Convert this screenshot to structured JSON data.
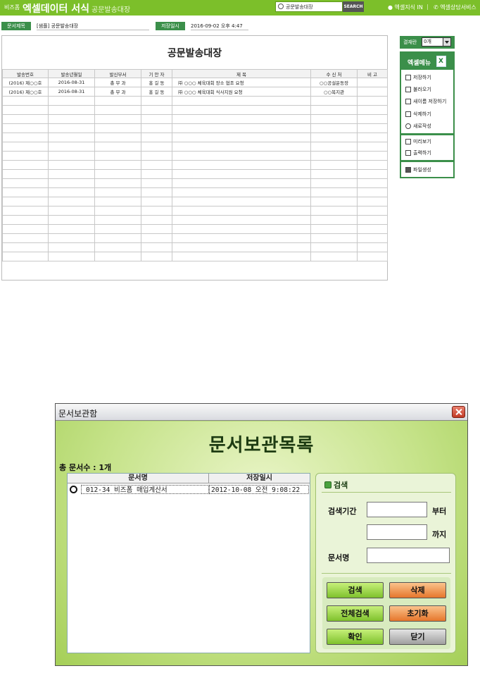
{
  "header": {
    "brand_small": "비즈폼",
    "brand_main": "엑셀데이터 서식",
    "brand_sub": "공문발송대장",
    "search_value": "공문발송대장",
    "search_button": "SEARCH",
    "link_knowledge": "엑셀지식 IN",
    "link_consult": "엑셀상담서비스"
  },
  "info": {
    "doc_title_label": "문서제목",
    "doc_title_value": "[샘플] 공문발송대장",
    "saved_label": "저장일시",
    "saved_value": "2016-09-02  오후 4:47"
  },
  "document": {
    "title": "공문발송대장",
    "columns": [
      "발송번호",
      "발송년월일",
      "발신부서",
      "기 안 자",
      "제        목",
      "수 신 처",
      "비    고"
    ],
    "rows": [
      [
        "(2016) 제○○호",
        "2016-08-31",
        "총 무 과",
        "홍 길 동",
        "㈜ ○○○ 체육대회 장소 협조 요청",
        "○○공설운동장",
        ""
      ],
      [
        "(2016) 제○○호",
        "2016-08-31",
        "총 무 과",
        "홍 길 동",
        "㈜ ○○○ 체육대회 식사지원 요청",
        "○○복지관",
        ""
      ]
    ]
  },
  "sidebar": {
    "approval_label": "결재란",
    "approval_value": "0개",
    "menu_title": "엑셀메뉴",
    "items": [
      {
        "label": "저장하기",
        "icon": "save-icon"
      },
      {
        "label": "불러오기",
        "icon": "load-icon"
      },
      {
        "label": "새이름 저장하기",
        "icon": "save-as-icon"
      },
      {
        "label": "삭제하기",
        "icon": "trash-icon"
      },
      {
        "label": "새로작성",
        "icon": "new-doc-icon"
      },
      {
        "label": "미리보기",
        "icon": "preview-icon"
      },
      {
        "label": "출력하기",
        "icon": "print-icon"
      },
      {
        "label": "파일생성",
        "icon": "folder-icon"
      }
    ]
  },
  "dialog": {
    "title": "문서보관함",
    "heading": "문서보관목록",
    "count_text": "총 문서수 : 1개",
    "list_headers": [
      "문서명",
      "저장일시"
    ],
    "list_rows": [
      {
        "name": "012-34_비즈폼 매입계산서",
        "date": "2012-10-08 오전 9:08:22"
      }
    ],
    "search_title": "검색",
    "period_label": "검색기간",
    "from_label": "부터",
    "to_label": "까지",
    "docname_label": "문서명",
    "buttons": {
      "search": "검색",
      "delete": "삭제",
      "search_all": "전체검색",
      "reset": "초기화",
      "confirm": "확인",
      "close": "닫기"
    }
  },
  "colors": {
    "topbar": "#7cbf2a",
    "accent_green": "#3b8f4a",
    "dialog_bg": "#b7d97a"
  }
}
